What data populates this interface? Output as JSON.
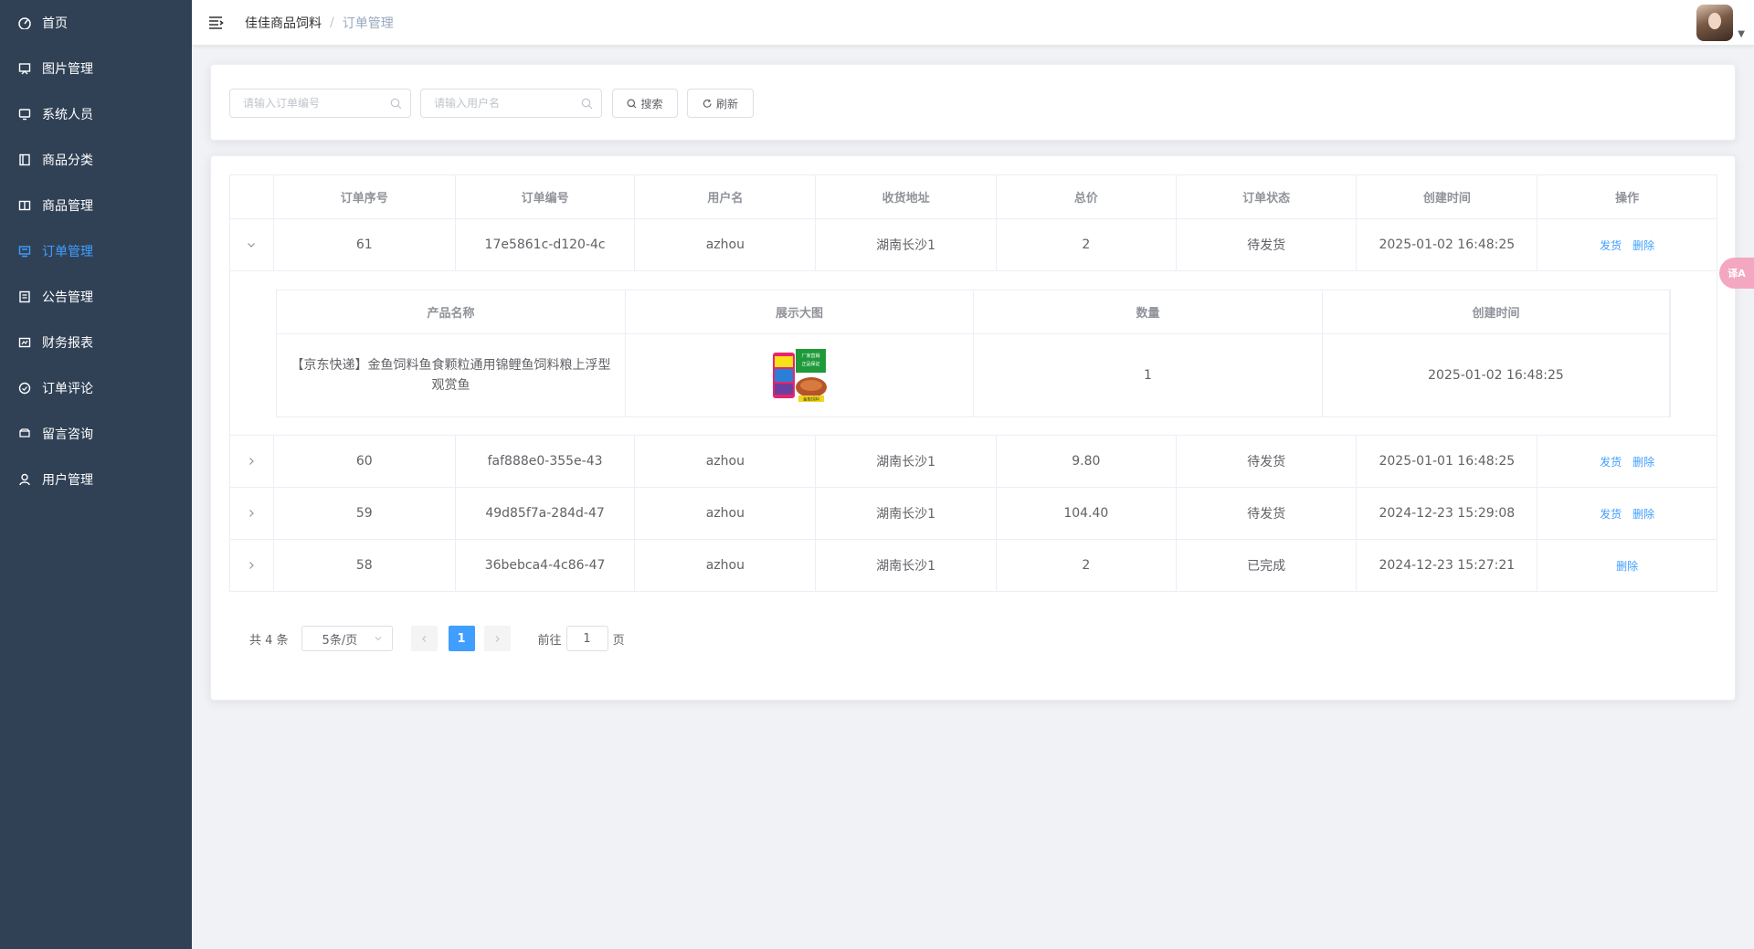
{
  "sidebar": {
    "items": [
      {
        "label": "首页",
        "icon": "dashboard-icon"
      },
      {
        "label": "图片管理",
        "icon": "image-icon"
      },
      {
        "label": "系统人员",
        "icon": "monitor-icon"
      },
      {
        "label": "商品分类",
        "icon": "category-icon"
      },
      {
        "label": "商品管理",
        "icon": "product-icon"
      },
      {
        "label": "订单管理",
        "icon": "order-icon",
        "active": true
      },
      {
        "label": "公告管理",
        "icon": "notice-icon"
      },
      {
        "label": "财务报表",
        "icon": "finance-icon"
      },
      {
        "label": "订单评论",
        "icon": "comment-icon"
      },
      {
        "label": "留言咨询",
        "icon": "message-icon"
      },
      {
        "label": "用户管理",
        "icon": "user-icon"
      }
    ],
    "bg_color": "#304156",
    "active_color": "#409eff"
  },
  "header": {
    "breadcrumb_home": "佳佳商品饲料",
    "breadcrumb_separator": "/",
    "breadcrumb_current": "订单管理"
  },
  "search": {
    "order_no_placeholder": "请输入订单编号",
    "username_placeholder": "请输入用户名",
    "search_label": "搜索",
    "refresh_label": "刷新"
  },
  "table": {
    "headers": [
      "订单序号",
      "订单编号",
      "用户名",
      "收货地址",
      "总价",
      "订单状态",
      "创建时间",
      "操作"
    ],
    "rows": [
      {
        "id": "61",
        "order_no": "17e5861c-d120-4c",
        "username": "azhou",
        "address": "湖南长沙1",
        "total": "2",
        "status": "待发货",
        "created": "2025-01-02 16:48:25",
        "ship": "发货",
        "delete": "删除",
        "expanded": true
      },
      {
        "id": "60",
        "order_no": "faf888e0-355e-43",
        "username": "azhou",
        "address": "湖南长沙1",
        "total": "9.80",
        "status": "待发货",
        "created": "2025-01-01 16:48:25",
        "ship": "发货",
        "delete": "删除"
      },
      {
        "id": "59",
        "order_no": "49d85f7a-284d-47",
        "username": "azhou",
        "address": "湖南长沙1",
        "total": "104.40",
        "status": "待发货",
        "created": "2024-12-23 15:29:08",
        "ship": "发货",
        "delete": "删除"
      },
      {
        "id": "58",
        "order_no": "36bebca4-4c86-47",
        "username": "azhou",
        "address": "湖南长沙1",
        "total": "2",
        "status": "已完成",
        "created": "2024-12-23 15:27:21",
        "ship": "",
        "delete": "删除"
      }
    ]
  },
  "detail": {
    "headers": [
      "产品名称",
      "展示大图",
      "数量",
      "创建时间"
    ],
    "product_name": "【京东快递】金鱼饲料鱼食颗粒通用锦鲤鱼饲料粮上浮型观赏鱼",
    "thumb_texts": [
      "厂家直销",
      "正品保证",
      "金鱼饲料"
    ],
    "quantity": "1",
    "created": "2025-01-02 16:48:25"
  },
  "pagination": {
    "total_text": "共 4 条",
    "page_size": "5条/页",
    "current_page": "1",
    "goto_label": "前往",
    "goto_value": "1",
    "page_suffix": "页"
  },
  "translate_badge": "译A"
}
